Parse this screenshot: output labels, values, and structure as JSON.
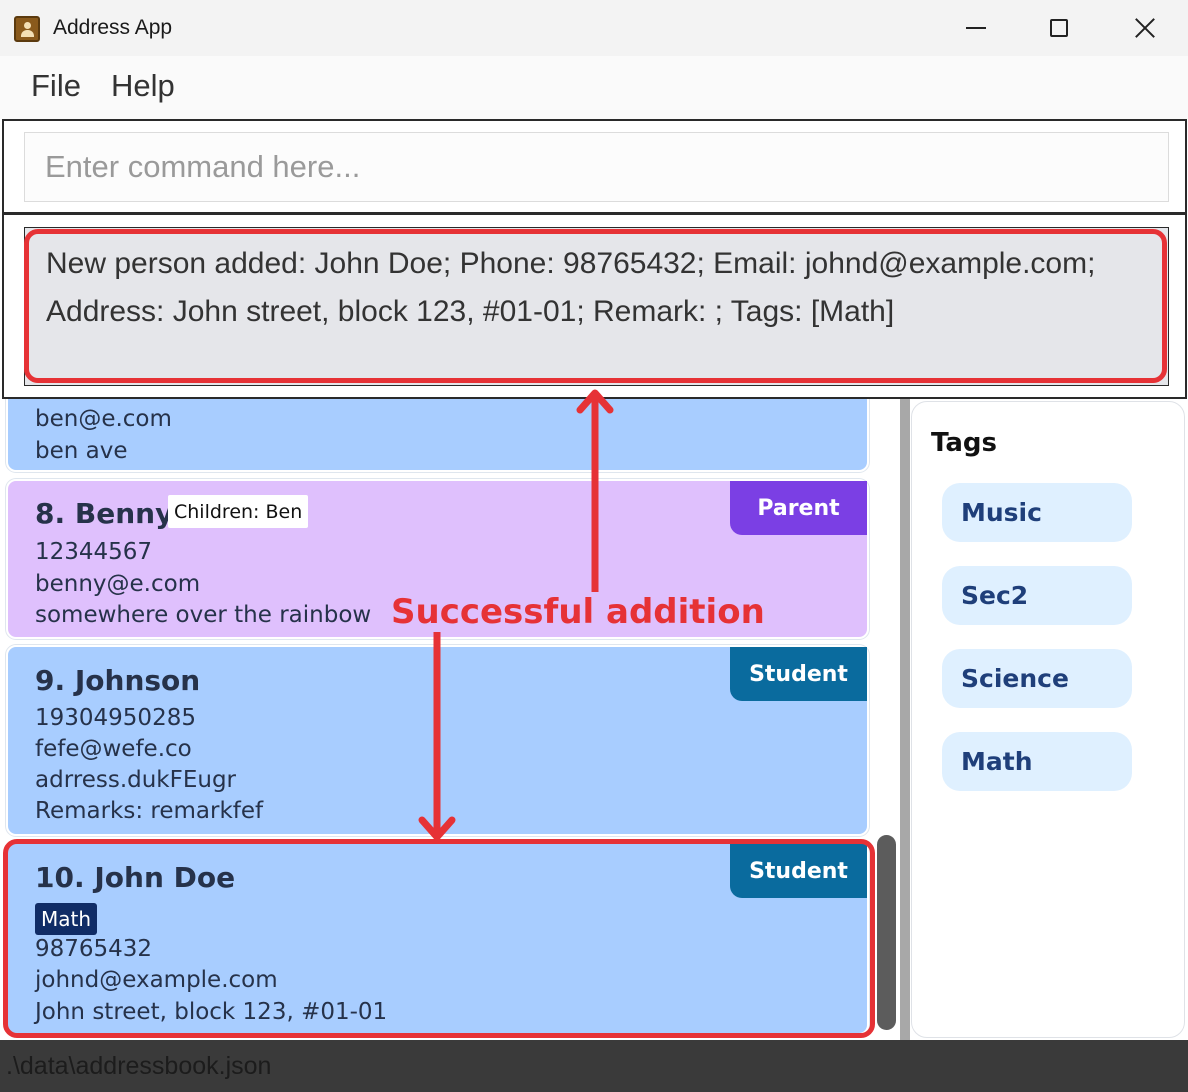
{
  "window": {
    "title": "Address App",
    "icon": "address-book-icon",
    "controls": [
      "minimize-icon",
      "maximize-icon",
      "close-icon"
    ]
  },
  "menu": {
    "file": "File",
    "help": "Help"
  },
  "command": {
    "placeholder": "Enter command here...",
    "value": ""
  },
  "result": {
    "line1": "New person added: John Doe; Phone: 98765432; Email: johnd@example.com;",
    "line2": "Address: John street, block 123, #01-01; Remark: ; Tags: [Math]"
  },
  "persons": [
    {
      "email": "ben@e.com",
      "address": "ben ave"
    },
    {
      "name": "8. Benny",
      "children": "Children: Ben",
      "phone": "12344567",
      "email": "benny@e.com",
      "address": "somewhere over the rainbow",
      "role": "Parent",
      "color": "#dfc0fd"
    },
    {
      "name": "9. Johnson",
      "phone": "19304950285",
      "email": "fefe@wefe.co",
      "address": "adrress.dukFEugr",
      "remarks": "Remarks: remarkfef",
      "role": "Student",
      "color": "#a8cdff"
    },
    {
      "name": "10. John Doe",
      "subject": "Math",
      "phone": "98765432",
      "email": "johnd@example.com",
      "address": "John street, block 123, #01-01",
      "role": "Student",
      "color": "#a8cdff"
    }
  ],
  "tags": {
    "title": "Tags",
    "items": [
      "Music",
      "Sec2",
      "Science",
      "Math"
    ]
  },
  "status": {
    "path": ".\\data\\addressbook.json"
  },
  "annotation": {
    "label": "Successful addition",
    "color": "#e63236"
  }
}
